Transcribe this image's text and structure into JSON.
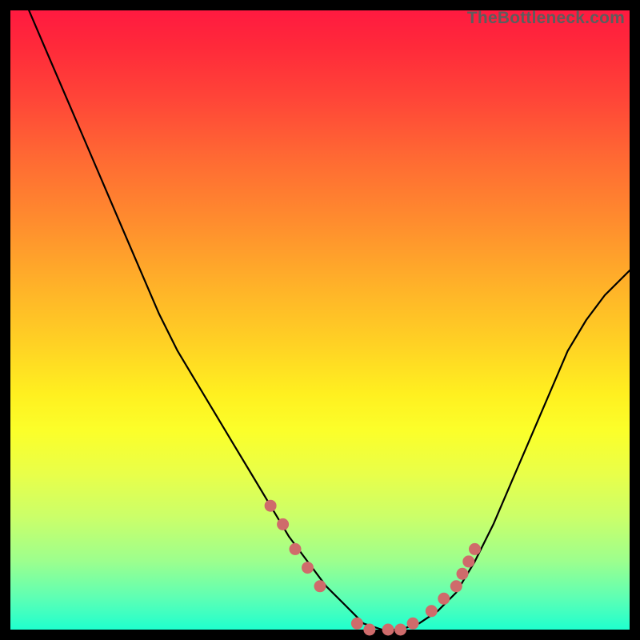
{
  "watermark": "TheBottleneck.com",
  "colors": {
    "curve_stroke": "#000000",
    "marker_fill": "#cf6b6b",
    "marker_stroke": "#cf6b6b",
    "background_black": "#000000"
  },
  "chart_data": {
    "type": "line",
    "title": "",
    "xlabel": "",
    "ylabel": "",
    "xlim": [
      0,
      100
    ],
    "ylim": [
      0,
      100
    ],
    "series": [
      {
        "name": "bottleneck-curve",
        "x": [
          0,
          3,
          6,
          9,
          12,
          15,
          18,
          21,
          24,
          27,
          30,
          33,
          36,
          39,
          42,
          45,
          48,
          51,
          54,
          57,
          60,
          63,
          66,
          69,
          72,
          75,
          78,
          81,
          84,
          87,
          90,
          93,
          96,
          100
        ],
        "y": [
          106,
          100,
          93,
          86,
          79,
          72,
          65,
          58,
          51,
          45,
          40,
          35,
          30,
          25,
          20,
          15,
          11,
          7,
          4,
          1,
          0,
          0,
          1,
          3,
          6,
          11,
          17,
          24,
          31,
          38,
          45,
          50,
          54,
          58
        ]
      }
    ],
    "markers": {
      "name": "highlight-dots",
      "x": [
        42,
        44,
        46,
        48,
        50,
        56,
        58,
        61,
        63,
        65,
        68,
        70,
        72,
        73,
        74,
        75
      ],
      "y": [
        20,
        17,
        13,
        10,
        7,
        1,
        0,
        0,
        0,
        1,
        3,
        5,
        7,
        9,
        11,
        13
      ]
    }
  }
}
